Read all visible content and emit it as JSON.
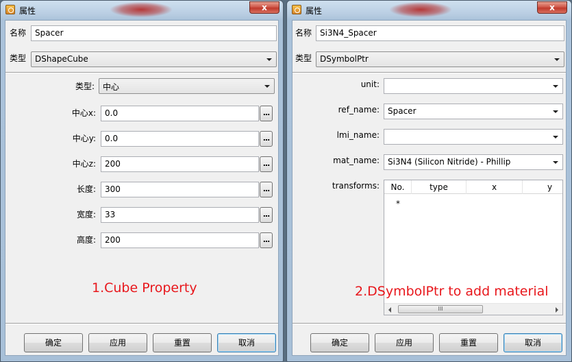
{
  "left_window": {
    "title": "属性",
    "close_label": "x",
    "name_label": "名称",
    "name_value": "Spacer",
    "type_label": "类型",
    "type_value": "DShapeCube",
    "fields": [
      {
        "label": "类型:",
        "value": "中心",
        "kind": "combo"
      },
      {
        "label": "中心x:",
        "value": "0.0",
        "kind": "text"
      },
      {
        "label": "中心y:",
        "value": "0.0",
        "kind": "text"
      },
      {
        "label": "中心z:",
        "value": "200",
        "kind": "text"
      },
      {
        "label": "长度:",
        "value": "300",
        "kind": "text"
      },
      {
        "label": "宽度:",
        "value": "33",
        "kind": "text"
      },
      {
        "label": "高度:",
        "value": "200",
        "kind": "text"
      }
    ],
    "dots_label": "...",
    "annotation": "1.Cube Property",
    "buttons": [
      "确定",
      "应用",
      "重置",
      "取消"
    ]
  },
  "right_window": {
    "title": "属性",
    "close_label": "x",
    "name_label": "名称",
    "name_value": "Si3N4_Spacer",
    "type_label": "类型",
    "type_value": "DSymbolPtr",
    "fields": [
      {
        "label": "unit:",
        "value": ""
      },
      {
        "label": "ref_name:",
        "value": "Spacer"
      },
      {
        "label": "lmi_name:",
        "value": ""
      },
      {
        "label": "mat_name:",
        "value": "Si3N4 (Silicon Nitride) - Phillip"
      }
    ],
    "transforms_label": "transforms:",
    "table": {
      "headers": [
        "No.",
        "type",
        "x",
        "y"
      ],
      "new_row_marker": "*",
      "scroll_thumb_grip": "III"
    },
    "annotation": "2.DSymbolPtr to add material",
    "buttons": [
      "确定",
      "应用",
      "重置",
      "取消"
    ]
  },
  "colors": {
    "annotation": "#e8171c",
    "title_blob": "#b53838",
    "close_button": "#c03a2c"
  }
}
